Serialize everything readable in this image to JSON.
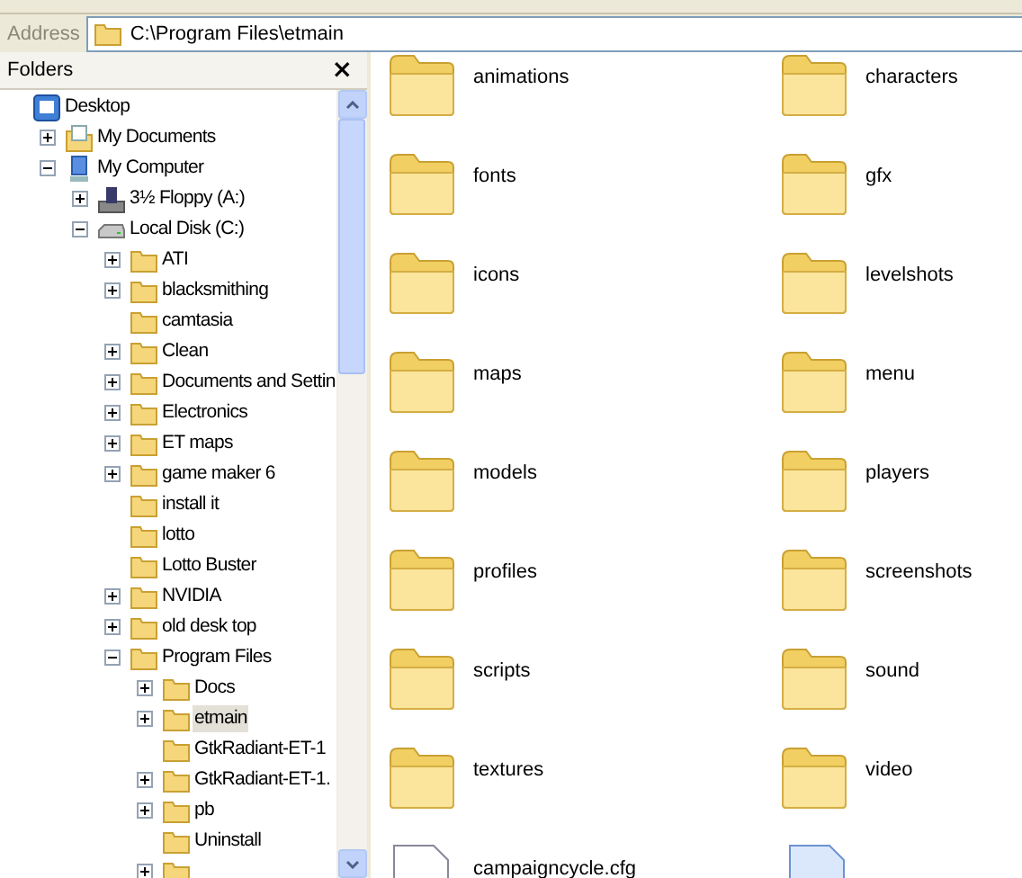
{
  "address": {
    "label": "Address",
    "value": "C:\\Program Files\\etmain"
  },
  "folders_pane": {
    "title": "Folders",
    "close": "×"
  },
  "tree": [
    {
      "label": "Desktop",
      "kind": "desktop",
      "selected": false,
      "children": [
        {
          "label": "My Documents",
          "kind": "documents",
          "expanded": false,
          "selected": false
        },
        {
          "label": "My Computer",
          "kind": "computer",
          "expanded": true,
          "selected": false,
          "children": [
            {
              "label": "3½ Floppy (A:)",
              "kind": "floppy",
              "expanded": false,
              "selected": false
            },
            {
              "label": "Local Disk (C:)",
              "kind": "disk",
              "expanded": true,
              "selected": false,
              "children": [
                {
                  "label": "ATI",
                  "kind": "folder",
                  "expanded": false,
                  "selected": false
                },
                {
                  "label": "blacksmithing",
                  "kind": "folder",
                  "expanded": false,
                  "selected": false
                },
                {
                  "label": "camtasia",
                  "kind": "folder",
                  "selected": false
                },
                {
                  "label": "Clean",
                  "kind": "folder",
                  "expanded": false,
                  "selected": false
                },
                {
                  "label": "Documents and Settin",
                  "kind": "folder",
                  "expanded": false,
                  "selected": false
                },
                {
                  "label": "Electronics",
                  "kind": "folder",
                  "expanded": false,
                  "selected": false
                },
                {
                  "label": "ET maps",
                  "kind": "folder",
                  "expanded": false,
                  "selected": false
                },
                {
                  "label": "game maker 6",
                  "kind": "folder",
                  "expanded": false,
                  "selected": false
                },
                {
                  "label": "install it",
                  "kind": "folder",
                  "selected": false
                },
                {
                  "label": "lotto",
                  "kind": "folder",
                  "selected": false
                },
                {
                  "label": "Lotto Buster",
                  "kind": "folder",
                  "selected": false
                },
                {
                  "label": "NVIDIA",
                  "kind": "folder",
                  "expanded": false,
                  "selected": false
                },
                {
                  "label": "old desk top",
                  "kind": "folder",
                  "expanded": false,
                  "selected": false
                },
                {
                  "label": "Program Files",
                  "kind": "folder",
                  "expanded": true,
                  "selected": false,
                  "children": [
                    {
                      "label": "Docs",
                      "kind": "folder",
                      "expanded": false,
                      "selected": false
                    },
                    {
                      "label": "etmain",
                      "kind": "folder",
                      "expanded": false,
                      "selected": true
                    },
                    {
                      "label": "GtkRadiant-ET-1",
                      "kind": "folder",
                      "selected": false
                    },
                    {
                      "label": "GtkRadiant-ET-1.",
                      "kind": "folder",
                      "expanded": false,
                      "selected": false
                    },
                    {
                      "label": "pb",
                      "kind": "folder",
                      "expanded": false,
                      "selected": false
                    },
                    {
                      "label": "Uninstall",
                      "kind": "folder",
                      "selected": false
                    },
                    {
                      "kind": "folder",
                      "expanded": false
                    }
                  ]
                }
              ]
            }
          ]
        }
      ]
    }
  ],
  "files": [
    {
      "label": "animations",
      "kind": "folder"
    },
    {
      "label": "characters",
      "kind": "folder"
    },
    {
      "label": "fonts",
      "kind": "folder"
    },
    {
      "label": "gfx",
      "kind": "folder"
    },
    {
      "label": "icons",
      "kind": "folder"
    },
    {
      "label": "levelshots",
      "kind": "folder"
    },
    {
      "label": "maps",
      "kind": "folder"
    },
    {
      "label": "menu",
      "kind": "folder"
    },
    {
      "label": "models",
      "kind": "folder"
    },
    {
      "label": "players",
      "kind": "folder"
    },
    {
      "label": "profiles",
      "kind": "folder"
    },
    {
      "label": "screenshots",
      "kind": "folder"
    },
    {
      "label": "scripts",
      "kind": "folder"
    },
    {
      "label": "sound",
      "kind": "folder"
    },
    {
      "label": "textures",
      "kind": "folder"
    },
    {
      "label": "video",
      "kind": "folder"
    },
    {
      "label": "campaigncycle.cfg",
      "kind": "cfg"
    },
    {
      "kind": "script"
    }
  ]
}
